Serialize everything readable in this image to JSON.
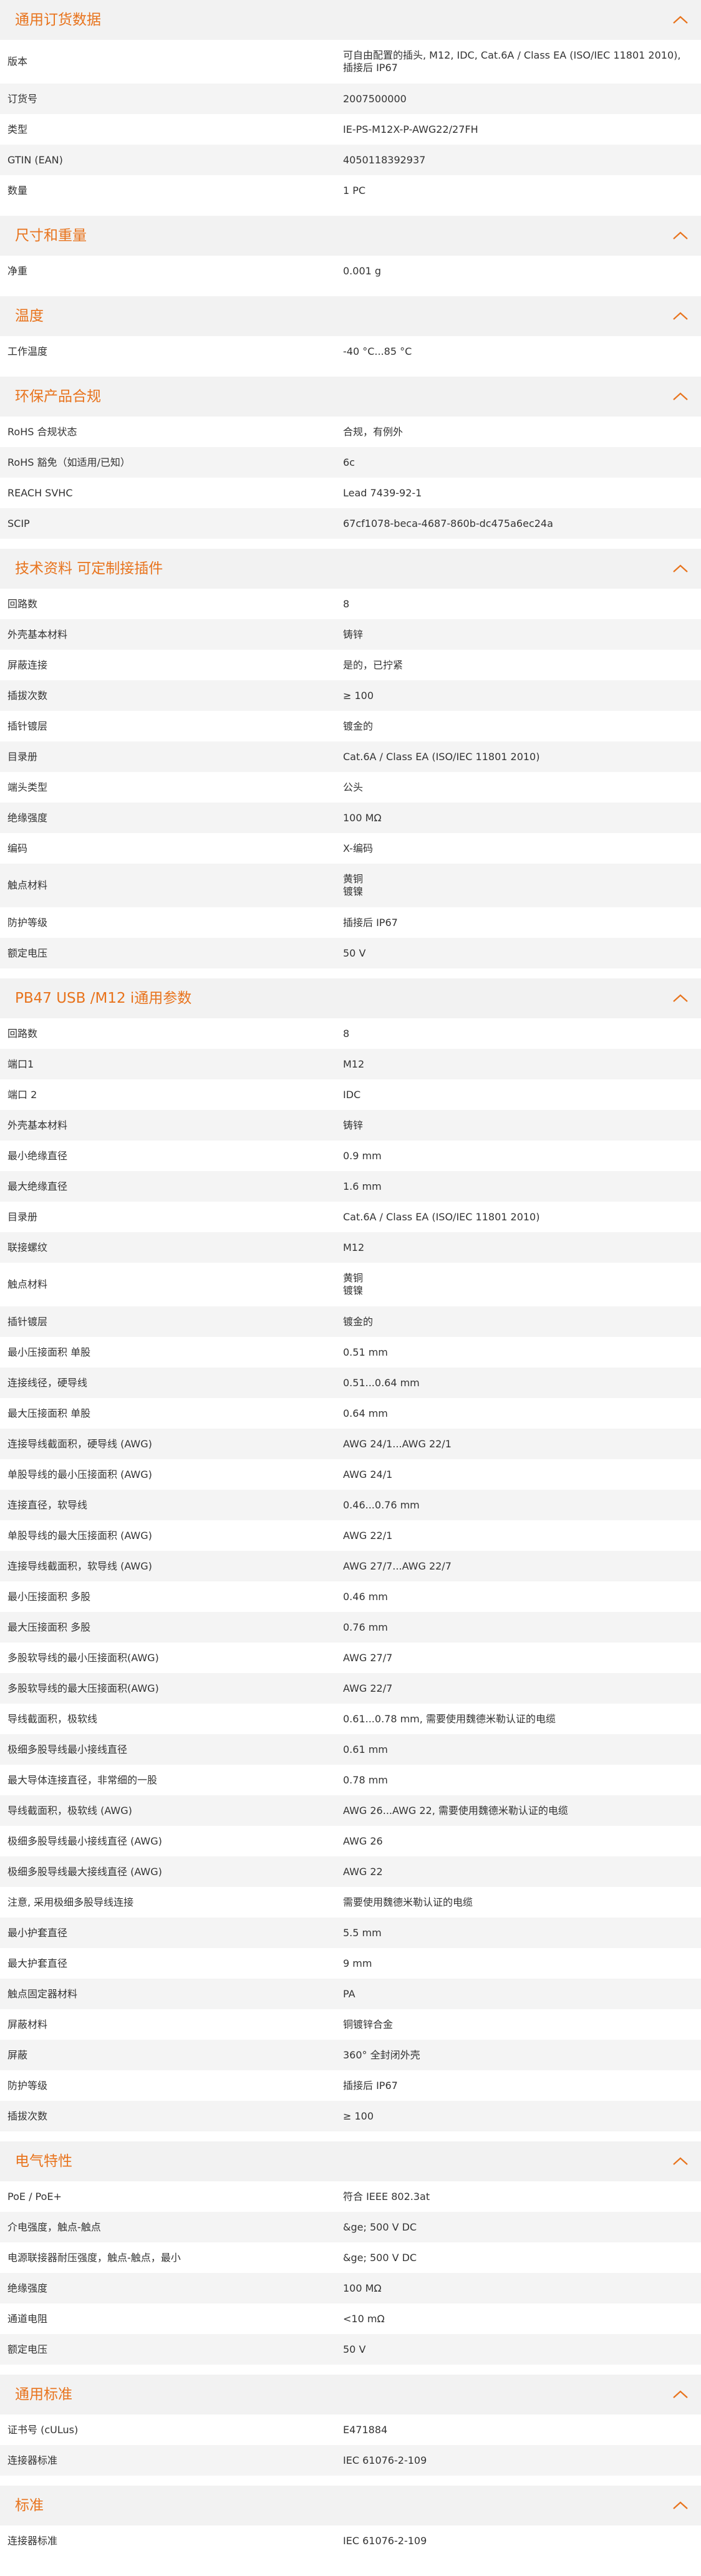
{
  "colors": {
    "accent": "#e8731c",
    "header_bg": "#f2f2f2",
    "row_alt": "#f4f4f4"
  },
  "sections": [
    {
      "title": "通用订货数据",
      "rows": [
        {
          "label": "版本",
          "value": "可自由配置的插头, M12, IDC, Cat.6A / Class EA (ISO/IEC 11801 2010),\n插接后 IP67"
        },
        {
          "label": "订货号",
          "value": "2007500000"
        },
        {
          "label": "类型",
          "value": "IE-PS-M12X-P-AWG22/27FH"
        },
        {
          "label": "GTIN (EAN)",
          "value": "4050118392937"
        },
        {
          "label": "数量",
          "value": "1  PC"
        }
      ]
    },
    {
      "title": "尺寸和重量",
      "rows": [
        {
          "label": "净重",
          "value": "0.001  g"
        }
      ]
    },
    {
      "title": "温度",
      "rows": [
        {
          "label": "工作温度",
          "value": "-40 °C...85 °C"
        }
      ]
    },
    {
      "title": "环保产品合规",
      "rows": [
        {
          "label": "RoHS 合规状态",
          "value": "合规，有例外"
        },
        {
          "label": "RoHS 豁免（如适用/已知）",
          "value": "6c"
        },
        {
          "label": "REACH SVHC",
          "value": "Lead 7439-92-1"
        },
        {
          "label": "SCIP",
          "value": "67cf1078-beca-4687-860b-dc475a6ec24a"
        }
      ]
    },
    {
      "title": "技术资料 可定制接插件",
      "rows": [
        {
          "label": "回路数",
          "value": "8"
        },
        {
          "label": "外壳基本材料",
          "value": "铸锌"
        },
        {
          "label": "屏蔽连接",
          "value": "是的，已拧紧"
        },
        {
          "label": "插拔次数",
          "value": "≥ 100"
        },
        {
          "label": "插针镀层",
          "value": "镀金的"
        },
        {
          "label": "目录册",
          "value": "Cat.6A / Class EA (ISO/IEC 11801 2010)"
        },
        {
          "label": "端头类型",
          "value": "公头"
        },
        {
          "label": "绝缘强度",
          "value": "100 MΩ"
        },
        {
          "label": "编码",
          "value": "X-编码"
        },
        {
          "label": "触点材料",
          "value": "黄铜\n镀镍"
        },
        {
          "label": "防护等级",
          "value": "插接后 IP67"
        },
        {
          "label": "额定电压",
          "value": "50  V"
        }
      ]
    },
    {
      "title": "PB47 USB /M12 i通用参数",
      "rows": [
        {
          "label": "回路数",
          "value": "8"
        },
        {
          "label": "端口1",
          "value": "M12"
        },
        {
          "label": "端口 2",
          "value": "IDC"
        },
        {
          "label": "外壳基本材料",
          "value": "铸锌"
        },
        {
          "label": "最小绝缘直径",
          "value": "0.9  mm"
        },
        {
          "label": "最大绝缘直径",
          "value": "1.6  mm"
        },
        {
          "label": "目录册",
          "value": "Cat.6A / Class EA (ISO/IEC 11801 2010)"
        },
        {
          "label": "联接螺纹",
          "value": "M12"
        },
        {
          "label": "触点材料",
          "value": "黄铜\n镀镍"
        },
        {
          "label": "插针镀层",
          "value": "镀金的"
        },
        {
          "label": "最小压接面积 单股",
          "value": "0.51  mm"
        },
        {
          "label": "连接线径，硬导线",
          "value": "0.51...0.64 mm"
        },
        {
          "label": "最大压接面积 单股",
          "value": "0.64  mm"
        },
        {
          "label": "连接导线截面积，硬导线 (AWG)",
          "value": "AWG 24/1...AWG 22/1"
        },
        {
          "label": "单股导线的最小压接面积 (AWG)",
          "value": "AWG 24/1"
        },
        {
          "label": "连接直径，软导线",
          "value": "0.46...0.76 mm"
        },
        {
          "label": "单股导线的最大压接面积 (AWG)",
          "value": "AWG 22/1"
        },
        {
          "label": "连接导线截面积，软导线 (AWG)",
          "value": "AWG 27/7...AWG 22/7"
        },
        {
          "label": "最小压接面积 多股",
          "value": "0.46  mm"
        },
        {
          "label": "最大压接面积 多股",
          "value": "0.76  mm"
        },
        {
          "label": "多股软导线的最小压接面积(AWG)",
          "value": "AWG 27/7"
        },
        {
          "label": "多股软导线的最大压接面积(AWG)",
          "value": "AWG 22/7"
        },
        {
          "label": "导线截面积，极软线",
          "value": "0.61...0.78 mm, 需要使用魏德米勒认证的电缆"
        },
        {
          "label": "极细多股导线最小接线直径",
          "value": "0.61  mm"
        },
        {
          "label": "最大导体连接直径，非常细的一股",
          "value": "0.78  mm"
        },
        {
          "label": "导线截面积，极软线 (AWG)",
          "value": "AWG 26...AWG 22, 需要使用魏德米勒认证的电缆"
        },
        {
          "label": "极细多股导线最小接线直径 (AWG)",
          "value": "AWG 26"
        },
        {
          "label": "极细多股导线最大接线直径 (AWG)",
          "value": "AWG 22"
        },
        {
          "label": "注意, 采用极细多股导线连接",
          "value": "需要使用魏德米勒认证的电缆"
        },
        {
          "label": "最小护套直径",
          "value": "5.5  mm"
        },
        {
          "label": "最大护套直径",
          "value": "9  mm"
        },
        {
          "label": "触点固定器材料",
          "value": "PA"
        },
        {
          "label": "屏蔽材料",
          "value": "铜镀锌合金"
        },
        {
          "label": "屏蔽",
          "value": "360° 全封闭外壳"
        },
        {
          "label": "防护等级",
          "value": "插接后 IP67"
        },
        {
          "label": "插拔次数",
          "value": "≥ 100"
        }
      ]
    },
    {
      "title": "电气特性",
      "rows": [
        {
          "label": "PoE / PoE+",
          "value": "符合 IEEE 802.3at"
        },
        {
          "label": "介电强度，触点-触点",
          "value": "&ge; 500 V DC"
        },
        {
          "label": "电源联接器耐压强度，触点-触点，最小",
          "value": "&ge; 500 V DC"
        },
        {
          "label": "绝缘强度",
          "value": "100 MΩ"
        },
        {
          "label": "通道电阻",
          "value": "<10 mΩ"
        },
        {
          "label": "额定电压",
          "value": "50  V"
        }
      ]
    },
    {
      "title": "通用标准",
      "rows": [
        {
          "label": "证书号 (cULus)",
          "value": "E471884"
        },
        {
          "label": "连接器标准",
          "value": "IEC 61076-2-109"
        }
      ]
    },
    {
      "title": "标准",
      "rows": [
        {
          "label": "连接器标准",
          "value": "IEC 61076-2-109"
        }
      ]
    }
  ],
  "icons": {
    "collapse": "chevron-up-icon"
  }
}
